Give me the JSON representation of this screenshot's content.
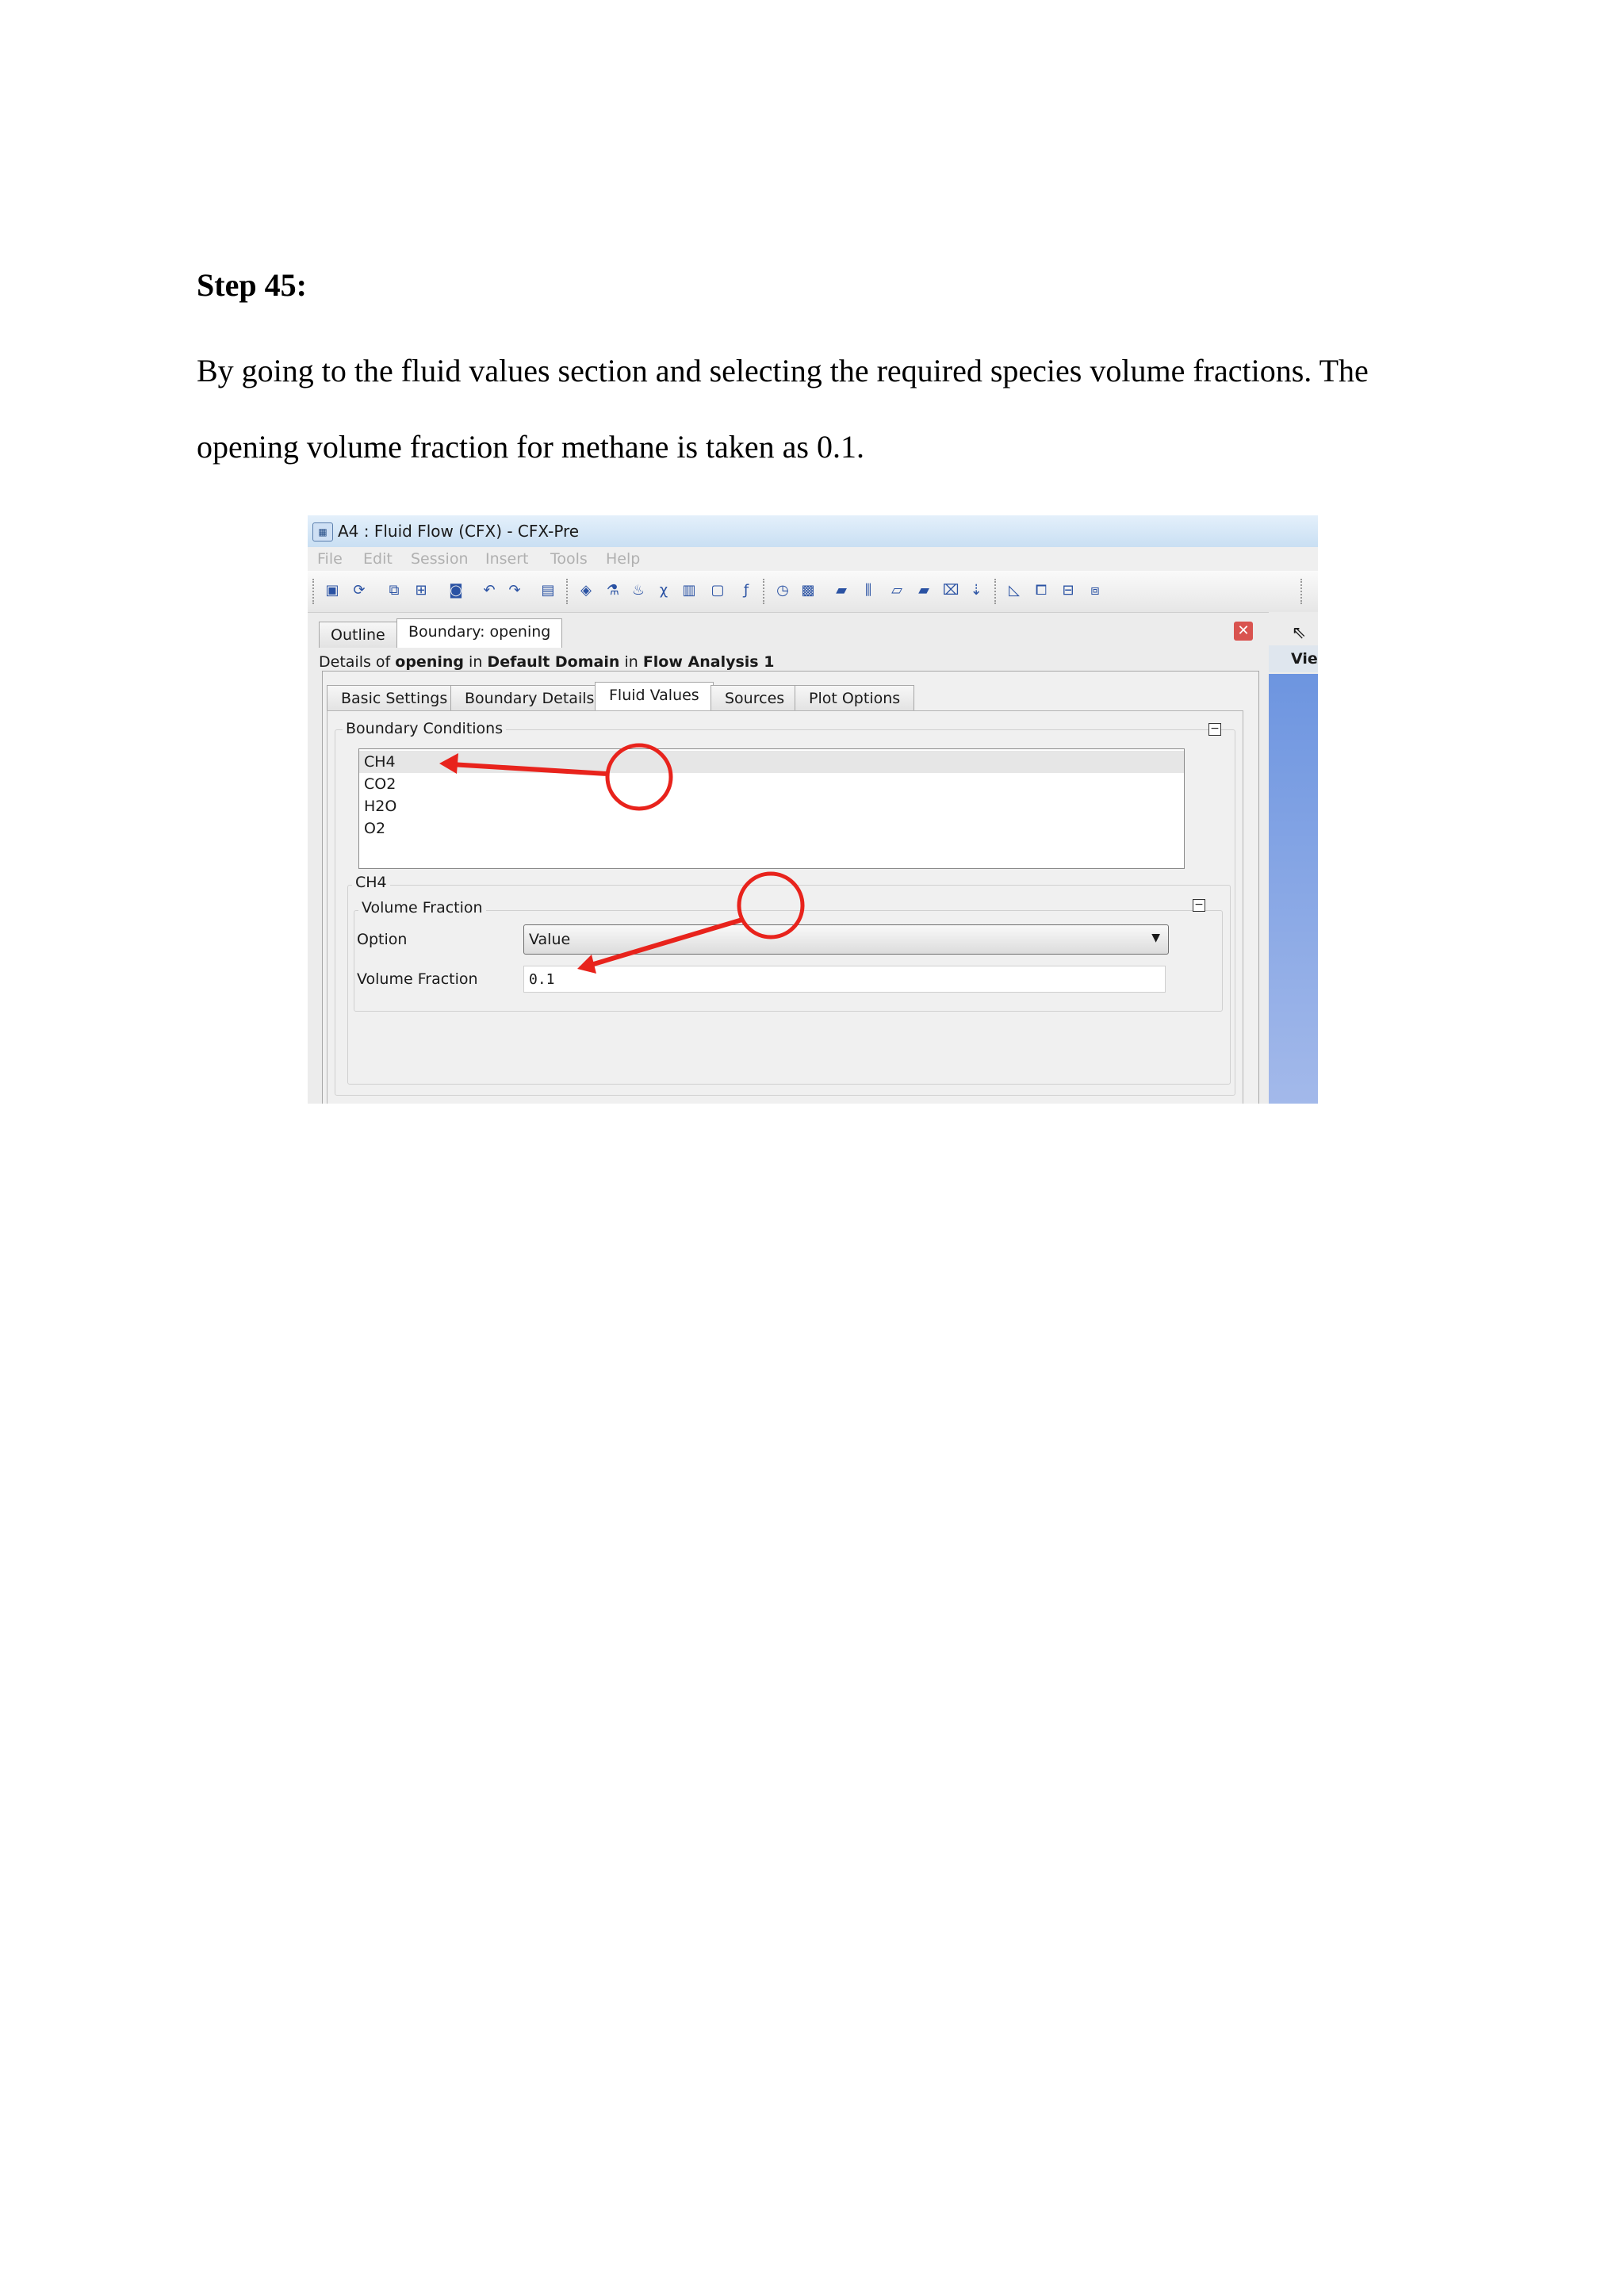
{
  "document": {
    "heading": "Step 45:",
    "paragraph": "By going to the fluid values section and selecting the required species volume fractions. The opening volume fraction for methane is taken as 0.1."
  },
  "window": {
    "title": "A4 : Fluid Flow (CFX) - CFX-Pre",
    "menu": [
      "File",
      "Edit",
      "Session",
      "Insert",
      "Tools",
      "Help"
    ]
  },
  "panel_tabs": [
    "Outline",
    "Boundary: opening"
  ],
  "details": {
    "prefix": "Details of",
    "object": "opening",
    "in1": "in",
    "domain": "Default Domain",
    "in2": "in",
    "analysis": "Flow Analysis 1"
  },
  "sub_tabs": [
    "Basic Settings",
    "Boundary Details",
    "Fluid Values",
    "Sources",
    "Plot Options"
  ],
  "boundary_conditions": {
    "label": "Boundary Conditions",
    "species": [
      "CH4",
      "CO2",
      "H2O",
      "O2"
    ],
    "selected": "CH4"
  },
  "species_section": {
    "label": "CH4",
    "volume_fraction_group": "Volume Fraction",
    "option_label": "Option",
    "option_value": "Value",
    "fraction_label": "Volume Fraction",
    "fraction_value": "0.1"
  },
  "viewer": {
    "header": "Vie"
  },
  "colors": {
    "annotation": "#e8231c",
    "viewport": "#6d95e0",
    "title_bar": "#c9dff3"
  }
}
